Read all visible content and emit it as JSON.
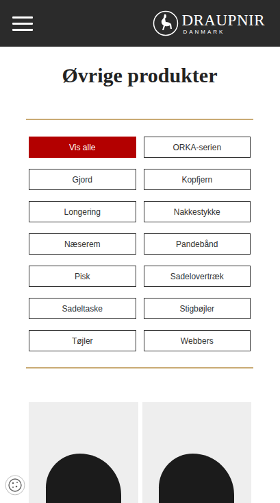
{
  "header": {
    "brand": "DRAUPNIR",
    "subbrand": "DANMARK"
  },
  "page": {
    "title": "Øvrige produkter"
  },
  "filters": [
    {
      "label": "Vis alle",
      "selected": true
    },
    {
      "label": "ORKA-serien",
      "selected": false
    },
    {
      "label": "Gjord",
      "selected": false
    },
    {
      "label": "Kopfjern",
      "selected": false
    },
    {
      "label": "Longering",
      "selected": false
    },
    {
      "label": "Nakkestykke",
      "selected": false
    },
    {
      "label": "Næserem",
      "selected": false
    },
    {
      "label": "Pandebånd",
      "selected": false
    },
    {
      "label": "Pisk",
      "selected": false
    },
    {
      "label": "Sadelovertræk",
      "selected": false
    },
    {
      "label": "Sadeltaske",
      "selected": false
    },
    {
      "label": "Stigbøjler",
      "selected": false
    },
    {
      "label": "Tøjler",
      "selected": false
    },
    {
      "label": "Webbers",
      "selected": false
    }
  ]
}
